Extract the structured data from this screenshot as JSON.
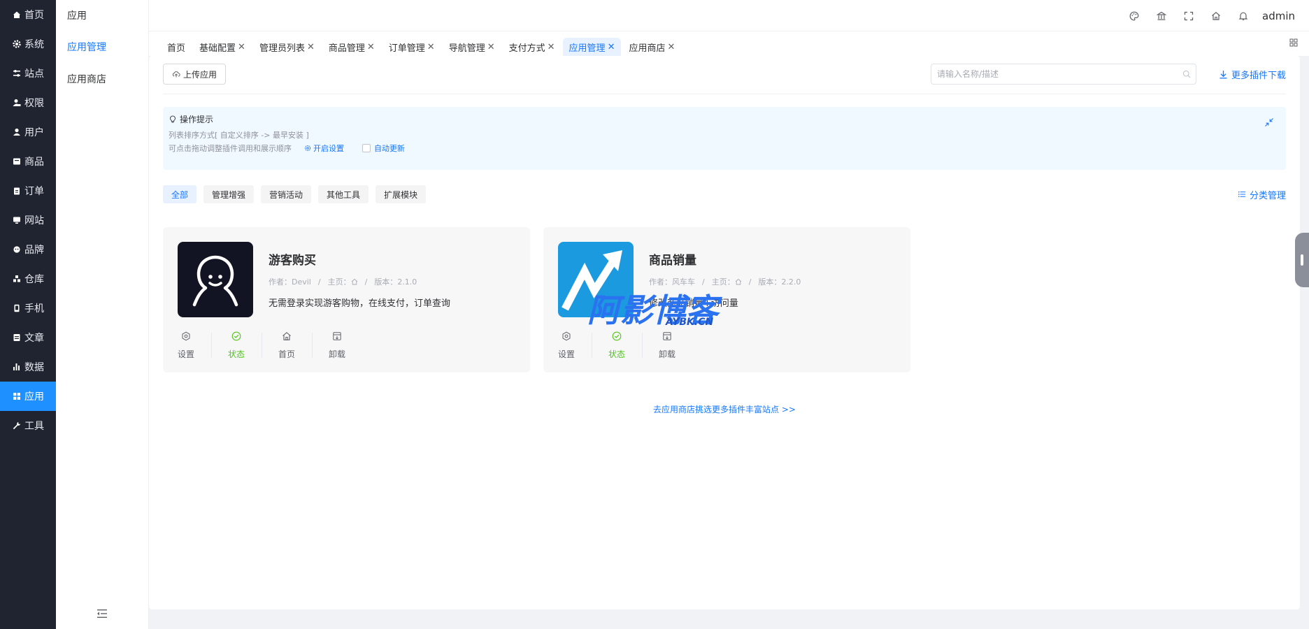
{
  "nav": {
    "items": [
      {
        "label": "首页",
        "icon": "home-icon"
      },
      {
        "label": "系统",
        "icon": "gear-icon"
      },
      {
        "label": "站点",
        "icon": "sliders-icon"
      },
      {
        "label": "权限",
        "icon": "user-lock-icon"
      },
      {
        "label": "用户",
        "icon": "user-icon"
      },
      {
        "label": "商品",
        "icon": "box-icon"
      },
      {
        "label": "订单",
        "icon": "clipboard-icon"
      },
      {
        "label": "网站",
        "icon": "monitor-icon"
      },
      {
        "label": "品牌",
        "icon": "headset-icon"
      },
      {
        "label": "仓库",
        "icon": "warehouse-icon"
      },
      {
        "label": "手机",
        "icon": "phone-icon"
      },
      {
        "label": "文章",
        "icon": "document-icon"
      },
      {
        "label": "数据",
        "icon": "bar-chart-icon"
      },
      {
        "label": "应用",
        "icon": "apps-icon",
        "active": true
      },
      {
        "label": "工具",
        "icon": "wrench-icon"
      }
    ]
  },
  "submenu": {
    "title": "应用",
    "items": [
      {
        "label": "应用管理",
        "active": true
      },
      {
        "label": "应用商店"
      }
    ]
  },
  "header": {
    "icons": [
      "palette-icon",
      "bank-icon",
      "fullscreen-icon",
      "home-icon",
      "bell-icon"
    ],
    "username": "admin"
  },
  "tabs": [
    {
      "label": "首页",
      "closable": false
    },
    {
      "label": "基础配置",
      "closable": true
    },
    {
      "label": "管理员列表",
      "closable": true
    },
    {
      "label": "商品管理",
      "closable": true
    },
    {
      "label": "订单管理",
      "closable": true
    },
    {
      "label": "导航管理",
      "closable": true
    },
    {
      "label": "支付方式",
      "closable": true
    },
    {
      "label": "应用管理",
      "closable": true,
      "active": true
    },
    {
      "label": "应用商店",
      "closable": true
    }
  ],
  "toolbar": {
    "upload_label": "上传应用",
    "search_placeholder": "请输入名称/描述",
    "more_label": "更多插件下载"
  },
  "tips": {
    "title": "操作提示",
    "line1": "列表排序方式[ 自定义排序 -> 最早安装 ]",
    "line2": "可点击拖动调整插件调用和展示顺序",
    "settings_link": "开启设置",
    "auto_update": "自动更新"
  },
  "filters": {
    "items": [
      "全部",
      "管理增强",
      "营销活动",
      "其他工具",
      "扩展模块"
    ],
    "active_index": 0,
    "category_manage": "分类管理"
  },
  "plugins": [
    {
      "name": "游客购买",
      "author_label": "作者：",
      "author": "Devil",
      "homepage_label": "主页：",
      "version_label": "版本：",
      "version": "2.1.0",
      "description": "无需登录实现游客购物，在线支付，订单查询",
      "logo_bg": "#121323",
      "actions": [
        "设置",
        "状态",
        "首页",
        "卸载"
      ]
    },
    {
      "name": "商品销量",
      "author_label": "作者：",
      "author": "风车车",
      "homepage_label": "主页：",
      "version_label": "版本：",
      "version": "2.2.0",
      "description": "修改商品销量+访问量",
      "logo_bg": "#1b9ae0",
      "actions": [
        "设置",
        "状态",
        "卸载"
      ]
    }
  ],
  "store_link": "去应用商店挑选更多插件丰富站点 >>",
  "watermark": {
    "main": "阿影博客",
    "sub": "AYBK.CN"
  },
  "colors": {
    "primary": "#1677ff",
    "nav_bg": "#1f2430",
    "nav_active": "#1e90ff",
    "success": "#52c41a",
    "tips_bg": "#f0f9ff"
  }
}
